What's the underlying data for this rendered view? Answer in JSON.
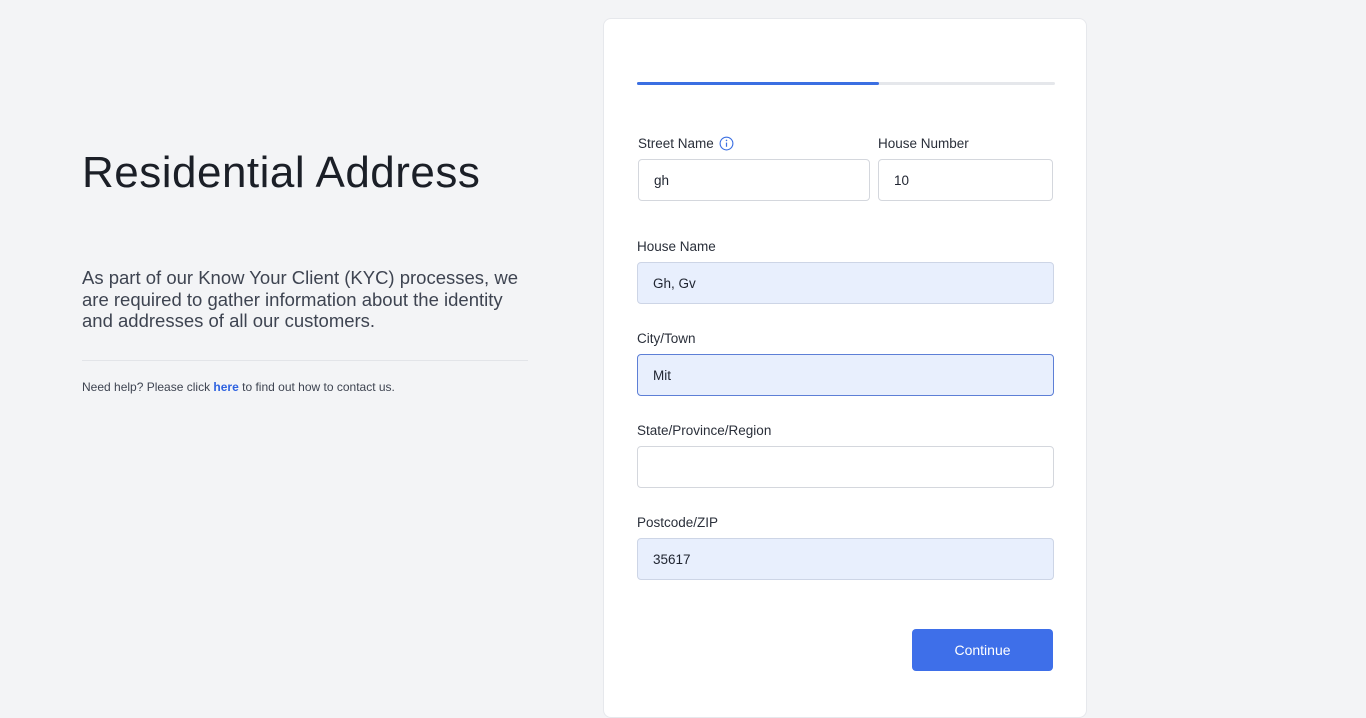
{
  "intro": {
    "title": "Residential Address",
    "description": "As part of our Know Your Client (KYC) processes, we are required to gather information about the identity and addresses of all our customers.",
    "help_prefix": "Need help? Please click ",
    "help_link": "here",
    "help_suffix": " to find out how to contact us."
  },
  "progress": {
    "fraction": 0.58,
    "color": "#3b6fe2"
  },
  "form": {
    "street_name": {
      "label": "Street Name",
      "value": "gh"
    },
    "house_number": {
      "label": "House Number",
      "value": "10"
    },
    "house_name": {
      "label": "House Name",
      "value": "Gh, Gv"
    },
    "city": {
      "label": "City/Town",
      "value": "Mit"
    },
    "state": {
      "label": "State/Province/Region",
      "value": ""
    },
    "postcode": {
      "label": "Postcode/ZIP",
      "value": "35617"
    },
    "continue_label": "Continue"
  },
  "icons": {
    "street_info": "info-icon"
  },
  "colors": {
    "accent": "#3e6fe9",
    "autofill": "#e8effd",
    "background": "#f3f4f6"
  }
}
